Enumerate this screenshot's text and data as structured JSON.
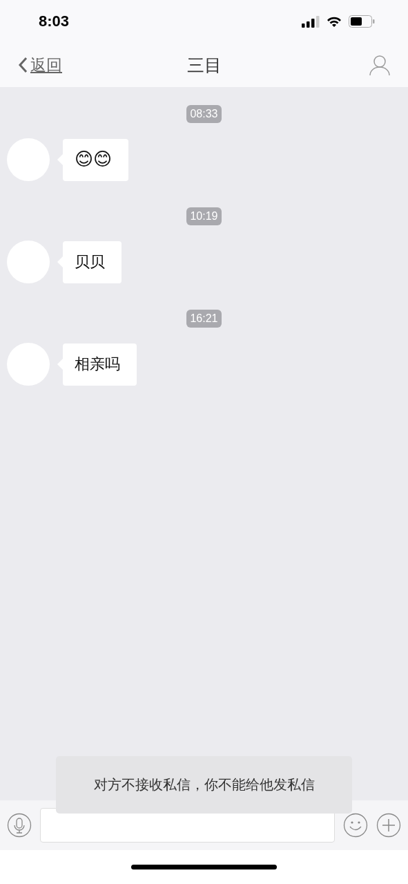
{
  "status_bar": {
    "time": "8:03"
  },
  "nav": {
    "back": "返回",
    "title": "三目"
  },
  "messages": [
    {
      "time": "08:33",
      "kind": "emoji",
      "text": "😊😊"
    },
    {
      "time": "10:19",
      "kind": "text",
      "text": "贝贝"
    },
    {
      "time": "16:21",
      "kind": "text",
      "text": "相亲吗"
    }
  ],
  "toast": "对方不接收私信，你不能给他发私信"
}
